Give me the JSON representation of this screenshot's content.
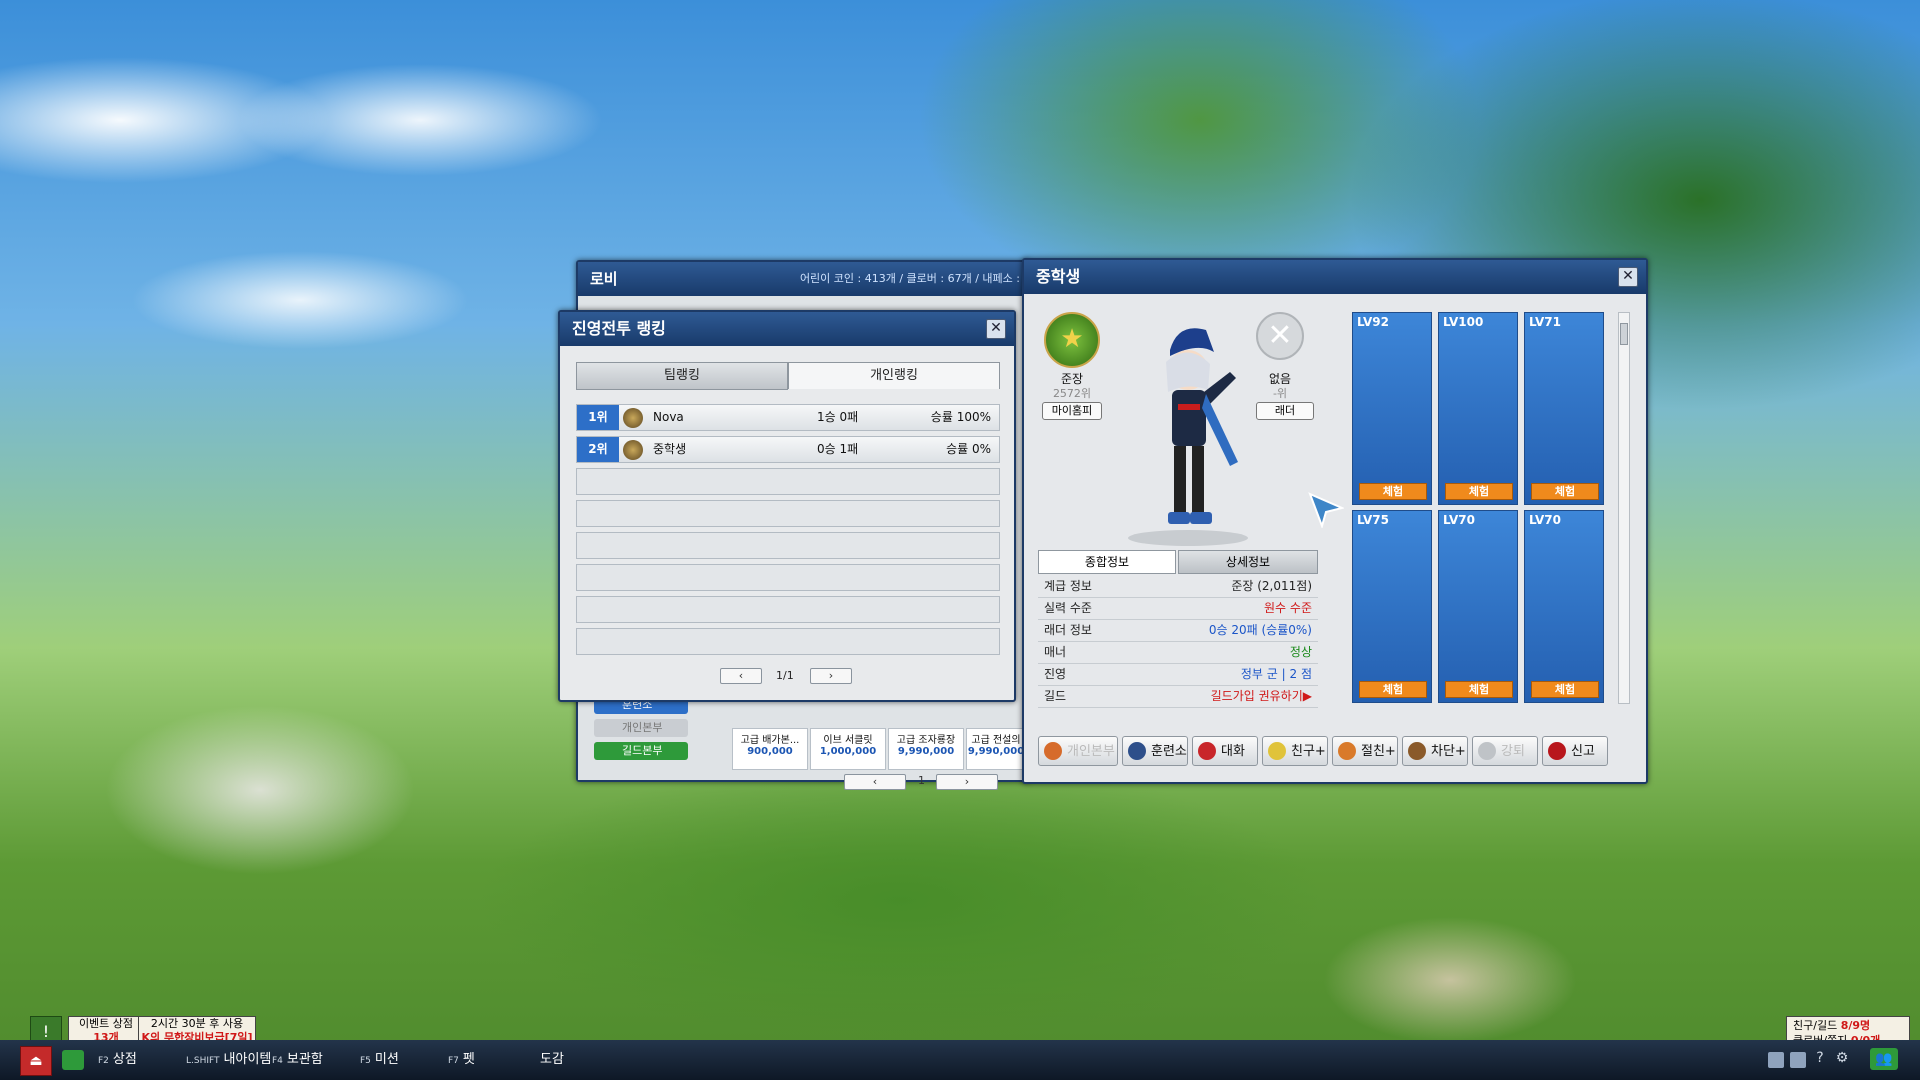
{
  "lobby": {
    "title": "로비",
    "stats": "어린이 코인 : 413개 / 클로버 : 67개 / 내페소 :",
    "side_buttons": [
      "훈련소",
      "개인본부",
      "길드본부"
    ],
    "items": [
      {
        "name": "고급 배가본...",
        "price": "900,000"
      },
      {
        "name": "이브 서클릿",
        "price": "1,000,000"
      },
      {
        "name": "고급 조자룡장",
        "price": "9,990,000"
      },
      {
        "name": "고급 전설의",
        "price": "9,990,000"
      }
    ],
    "page": "1"
  },
  "ranking": {
    "title": "진영전투 랭킹",
    "tabs": [
      "팀랭킹",
      "개인랭킹"
    ],
    "rows": [
      {
        "rank": "1위",
        "name": "Nova",
        "record": "1승 0패",
        "rate": "승률 100%"
      },
      {
        "rank": "2위",
        "name": "중학생",
        "record": "0승 1패",
        "rate": "승률 0%"
      }
    ],
    "page": "1/1"
  },
  "profile": {
    "title": "중학생",
    "rank_badge": {
      "label": "준장",
      "sub": "2572위",
      "button": "마이홈피"
    },
    "ladder_badge": {
      "label": "없음",
      "sub": "-위",
      "button": "래더"
    },
    "tabs": [
      "종합정보",
      "상세정보"
    ],
    "info": [
      {
        "key": "계급 정보",
        "value": "준장 (2,011점)",
        "color": "#222222"
      },
      {
        "key": "실력 수준",
        "value": "원수 수준",
        "color": "#d01818"
      },
      {
        "key": "래더 정보",
        "value": "0승 20패 (승률0%)",
        "color": "#1b55c8"
      },
      {
        "key": "매너",
        "value": "정상",
        "color": "#1a8a1a"
      },
      {
        "key": "진영",
        "value": "정부 군 | 2 점",
        "color": "#1b55c8"
      },
      {
        "key": "길드",
        "value": "길드가입 권유하기▶",
        "color": "#d01818"
      }
    ],
    "slots": [
      {
        "level": "LV92",
        "btn": "체험"
      },
      {
        "level": "LV100",
        "btn": "체험"
      },
      {
        "level": "LV71",
        "btn": "체험"
      },
      {
        "level": "LV75",
        "btn": "체험"
      },
      {
        "level": "LV70",
        "btn": "체험"
      },
      {
        "level": "LV70",
        "btn": "체험"
      }
    ],
    "actions": [
      "개인본부",
      "훈련소",
      "대화",
      "친구+",
      "절친+",
      "차단+",
      "강퇴",
      "신고"
    ]
  },
  "notifications": {
    "event": "이벤트 상점",
    "event_count": "13개",
    "timer": "2시간 30분 후 사용",
    "reward": "K의 무한장비보급[7일]"
  },
  "taskbar": {
    "items": [
      {
        "key": "F2",
        "label": "상점"
      },
      {
        "key": "L.SHIFT",
        "label": "내아이템"
      },
      {
        "key": "F4",
        "label": "보관함"
      },
      {
        "key": "F5",
        "label": "미션"
      },
      {
        "key": "F7",
        "label": "펫"
      },
      {
        "key": "",
        "label": "도감"
      }
    ],
    "friend_label": "친구/길드",
    "friend_value": "8/9명",
    "clover_label": "클로버/쪽지",
    "clover_value": "0/0개"
  },
  "colors": {
    "accent_blue": "#2d6fc8",
    "title_bar": "#183a6a",
    "try_button": "#f08a1c"
  }
}
